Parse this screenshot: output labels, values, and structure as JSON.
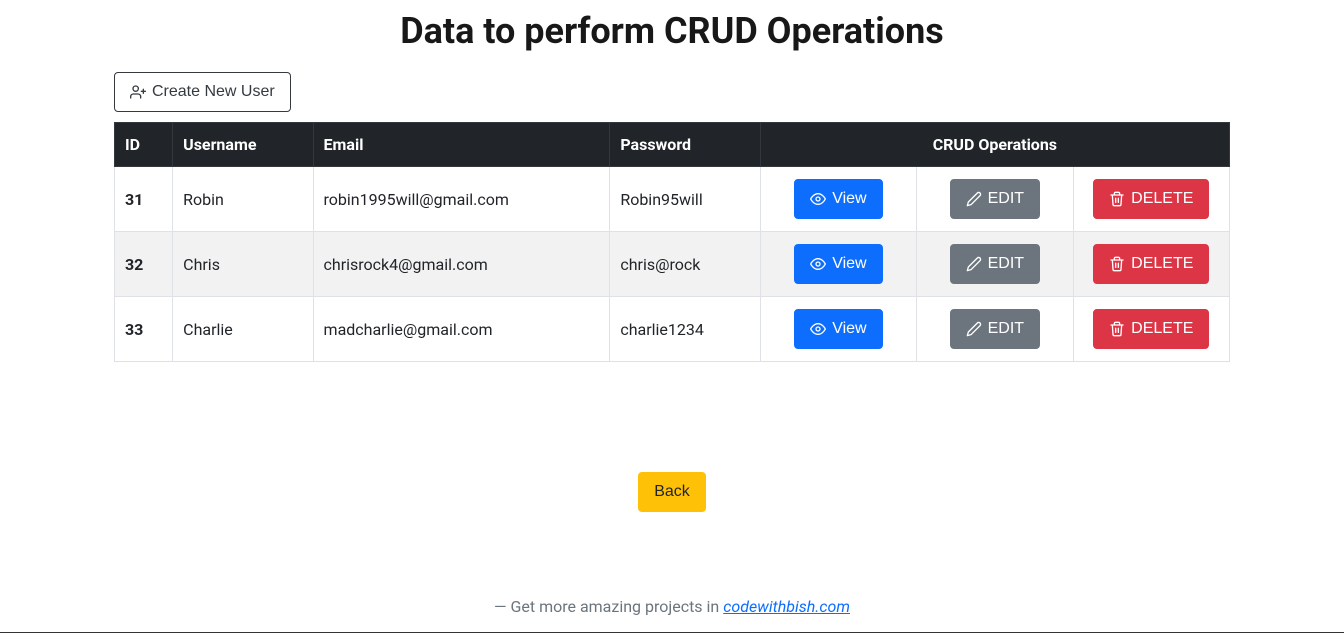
{
  "page": {
    "title": "Data to perform CRUD Operations",
    "create_label": "Create New User",
    "back_label": "Back"
  },
  "table": {
    "headers": {
      "id": "ID",
      "username": "Username",
      "email": "Email",
      "password": "Password",
      "ops": "CRUD Operations"
    },
    "buttons": {
      "view": "View",
      "edit": "EDIT",
      "delete": "DELETE"
    },
    "rows": [
      {
        "id": "31",
        "username": "Robin",
        "email": "robin1995will@gmail.com",
        "password": "Robin95will"
      },
      {
        "id": "32",
        "username": "Chris",
        "email": "chrisrock4@gmail.com",
        "password": "chris@rock"
      },
      {
        "id": "33",
        "username": "Charlie",
        "email": "madcharlie@gmail.com",
        "password": "charlie1234"
      }
    ]
  },
  "footer": {
    "prefix": "— Get more amazing projects in ",
    "link_text": "codewithbish.com"
  }
}
